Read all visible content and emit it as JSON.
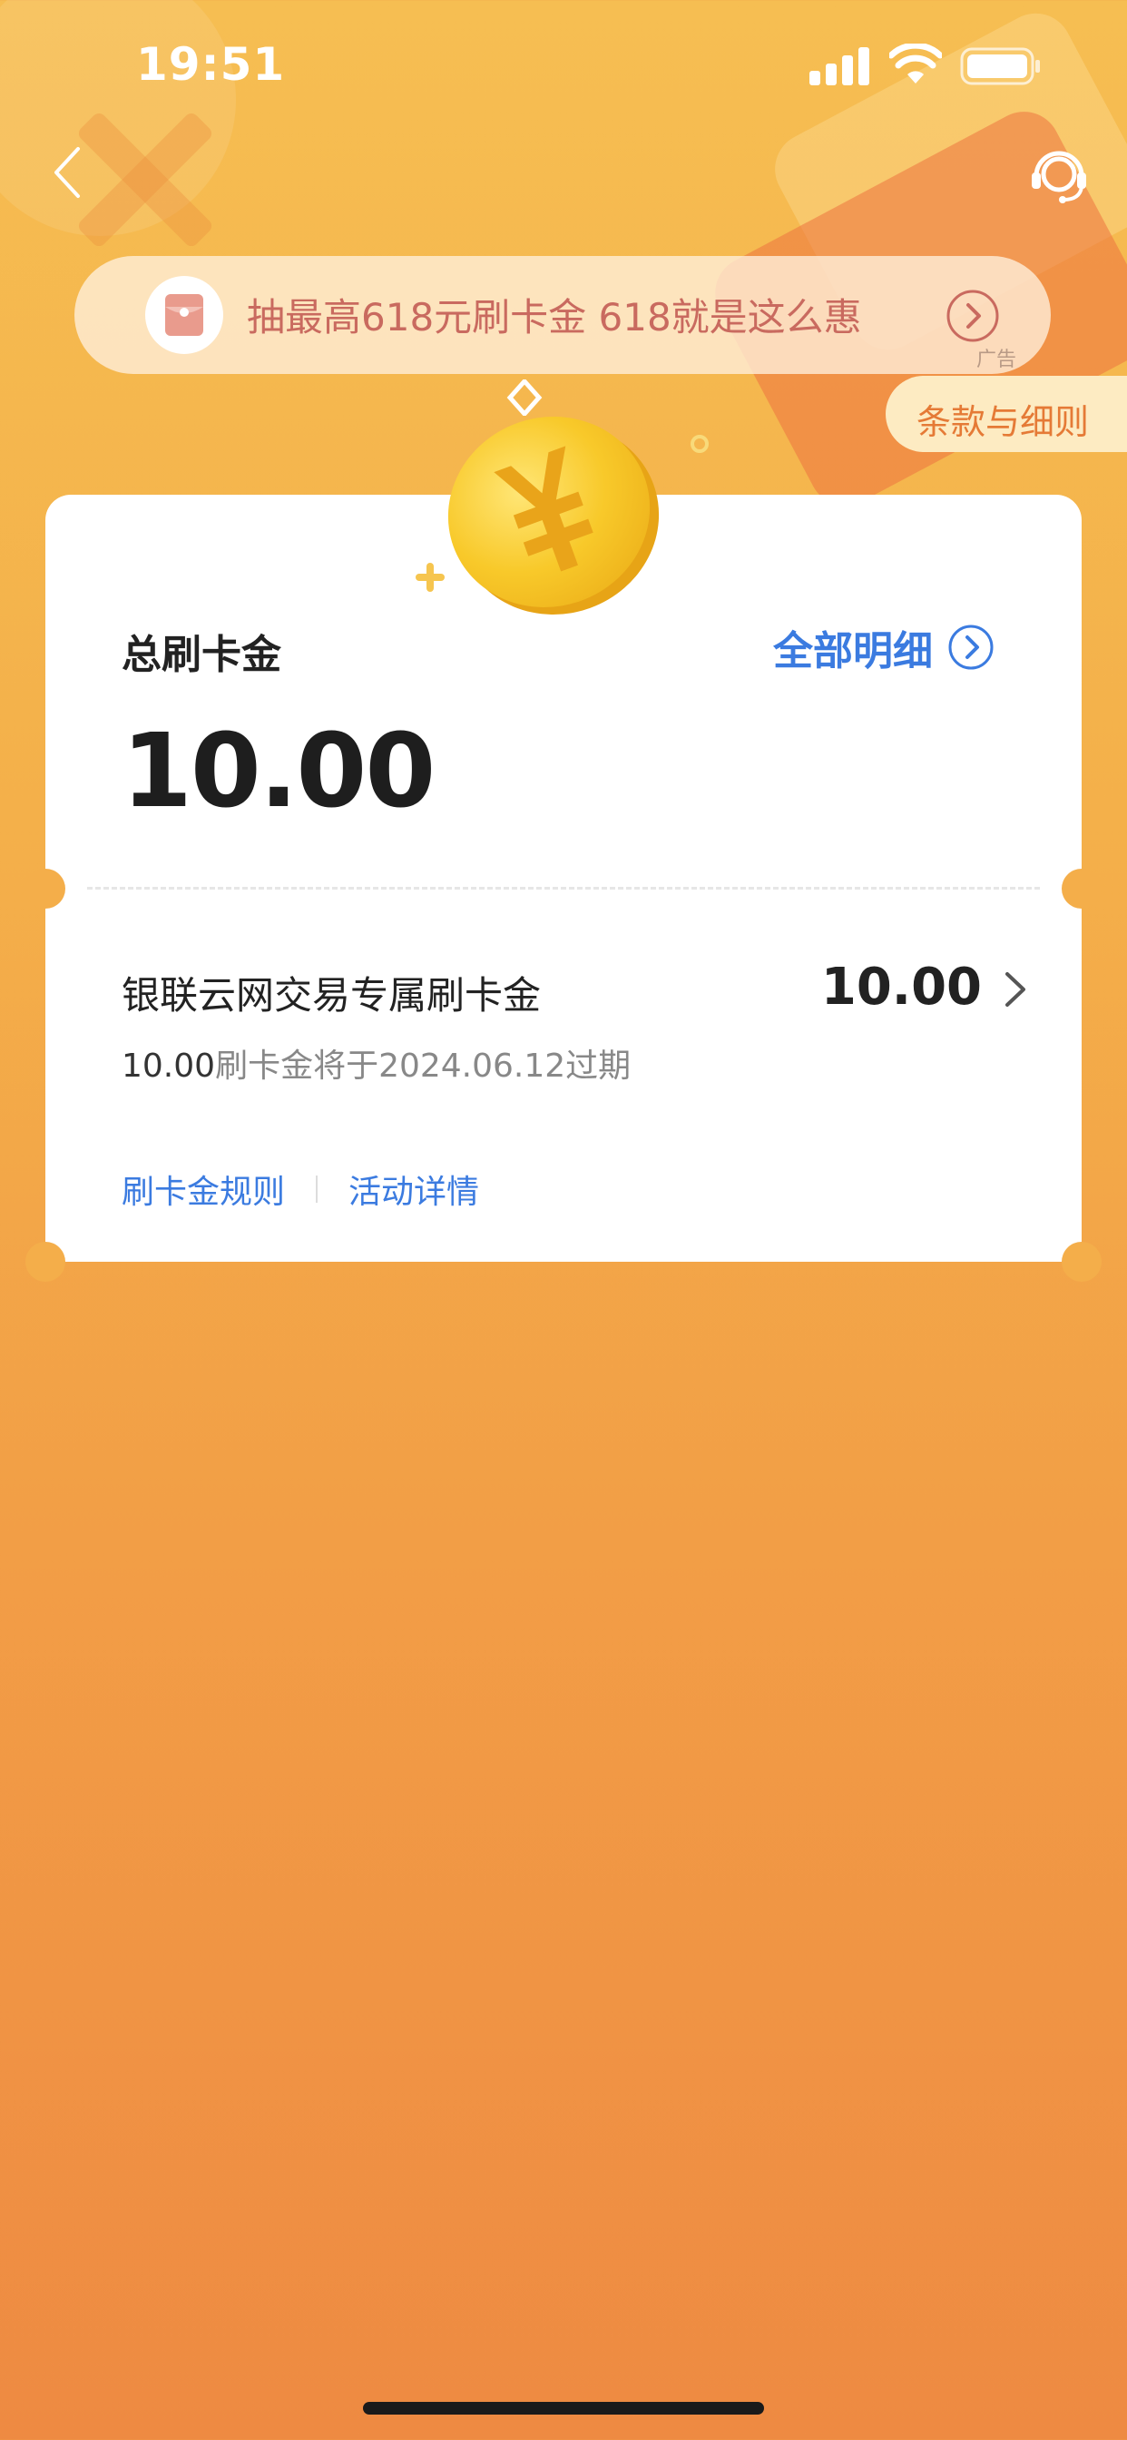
{
  "status_bar": {
    "time": "19:51"
  },
  "nav": {
    "back_icon": "chevron-left-icon",
    "service_icon": "customer-service-icon"
  },
  "ad_banner": {
    "text": "抽最高618元刷卡金  618就是这么惠",
    "label": "广告",
    "icon": "gift-icon"
  },
  "terms": {
    "label": "条款与细则"
  },
  "summary": {
    "title": "总刷卡金",
    "all_details": "全部明细",
    "total": "10.00"
  },
  "item": {
    "title": "银联云网交易专属刷卡金",
    "amount": "10.00",
    "expiry_amount": "10.00",
    "expiry_text": "刷卡金将于2024.06.12过期"
  },
  "links": {
    "rules": "刷卡金规则",
    "activity": "活动详情"
  },
  "colors": {
    "accent_blue": "#3B7BE0",
    "background_top": "#F6BE52",
    "background_bottom": "#EE8A42",
    "terms_text": "#E57A36",
    "ad_text": "#C96A5F"
  }
}
